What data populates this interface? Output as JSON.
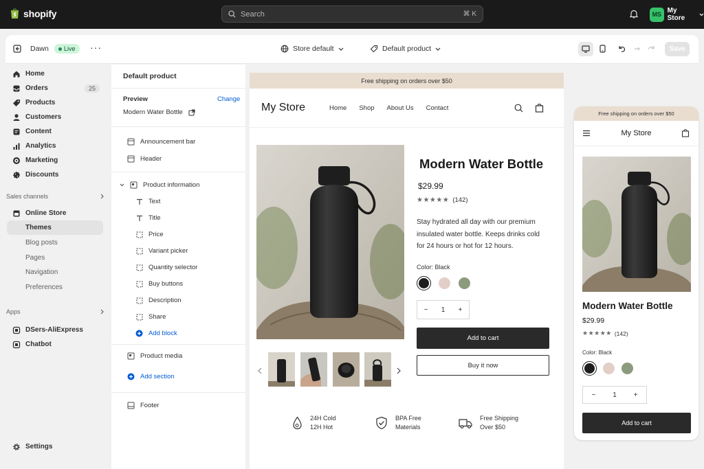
{
  "topbar": {
    "logo": "shopify",
    "search_placeholder": "Search",
    "search_shortcut": "⌘ K",
    "store_initials": "MS",
    "store_name": "My Store"
  },
  "toolbar": {
    "theme_name": "Dawn",
    "live_badge": "Live",
    "template_selector": "Store default",
    "product_selector": "Default product",
    "save_label": "Save"
  },
  "nav": {
    "items": [
      {
        "label": "Home",
        "icon": "home-icon"
      },
      {
        "label": "Orders",
        "icon": "orders-icon",
        "count": "25"
      },
      {
        "label": "Products",
        "icon": "tag-icon"
      },
      {
        "label": "Customers",
        "icon": "person-icon"
      },
      {
        "label": "Content",
        "icon": "content-icon"
      },
      {
        "label": "Analytics",
        "icon": "chart-icon"
      },
      {
        "label": "Marketing",
        "icon": "target-icon"
      },
      {
        "label": "Discounts",
        "icon": "discount-icon"
      }
    ],
    "sales_channels_label": "Sales channels",
    "online_store": "Online Store",
    "sub_items": [
      "Themes",
      "Blog posts",
      "Pages",
      "Navigation",
      "Preferences"
    ],
    "apps_label": "Apps",
    "apps": [
      "DSers-AliExpress",
      "Chatbot"
    ],
    "settings": "Settings"
  },
  "panel": {
    "title": "Default product",
    "preview_label": "Preview",
    "change_link": "Change",
    "preview_product": "Modern Water Bottle",
    "announcement_bar": "Announcement bar",
    "header": "Header",
    "product_information": "Product information",
    "blocks": [
      "Text",
      "Title",
      "Price",
      "Variant picker",
      "Quantity selector",
      "Buy buttons",
      "Description",
      "Share"
    ],
    "add_block": "Add block",
    "product_media": "Product media",
    "add_section": "Add section",
    "footer": "Footer"
  },
  "preview": {
    "announcement": "Free shipping on orders over $50",
    "store_name": "My Store",
    "menu": [
      "Home",
      "Shop",
      "About Us",
      "Contact"
    ],
    "product_title": "Modern Water Bottle",
    "price": "$29.99",
    "rating": 4.5,
    "review_count": "(142)",
    "description": [
      "Stay hydrated all day with our premium",
      "insulated water bottle. Keeps drinks cold",
      "for 24 hours or hot for 12 hours."
    ],
    "color_label": "Color:",
    "color_value": "Black",
    "swatches": [
      "#1e1e1e",
      "#e3cfc8",
      "#8c9a7d"
    ],
    "quantity": "1",
    "add_to_cart": "Add to cart",
    "buy_now": "Buy it now",
    "features": [
      {
        "line1": "24H Cold",
        "line2": "12H Hot",
        "icon": "temperature-drop-icon"
      },
      {
        "line1": "BPA Free",
        "line2": "Materials",
        "icon": "shield-check-icon"
      },
      {
        "line1": "Free Shipping",
        "line2": "Over $50",
        "icon": "truck-icon"
      }
    ]
  },
  "mobile": {
    "announcement": "Free shipping on orders over $50",
    "store_name": "My Store",
    "product_title": "Modern Water Bottle",
    "price": "$29.99",
    "review_count": "(142)",
    "color_label": "Color:",
    "color_value": "Black",
    "quantity": "1",
    "add_to_cart": "Add to cart"
  },
  "colors": {
    "topbar": "#1a1a1a",
    "accent_blue": "#005bd3",
    "live_green": "#29845a",
    "button_dark": "#2a2a2a",
    "announcement_bg": "#e9ddd0"
  }
}
